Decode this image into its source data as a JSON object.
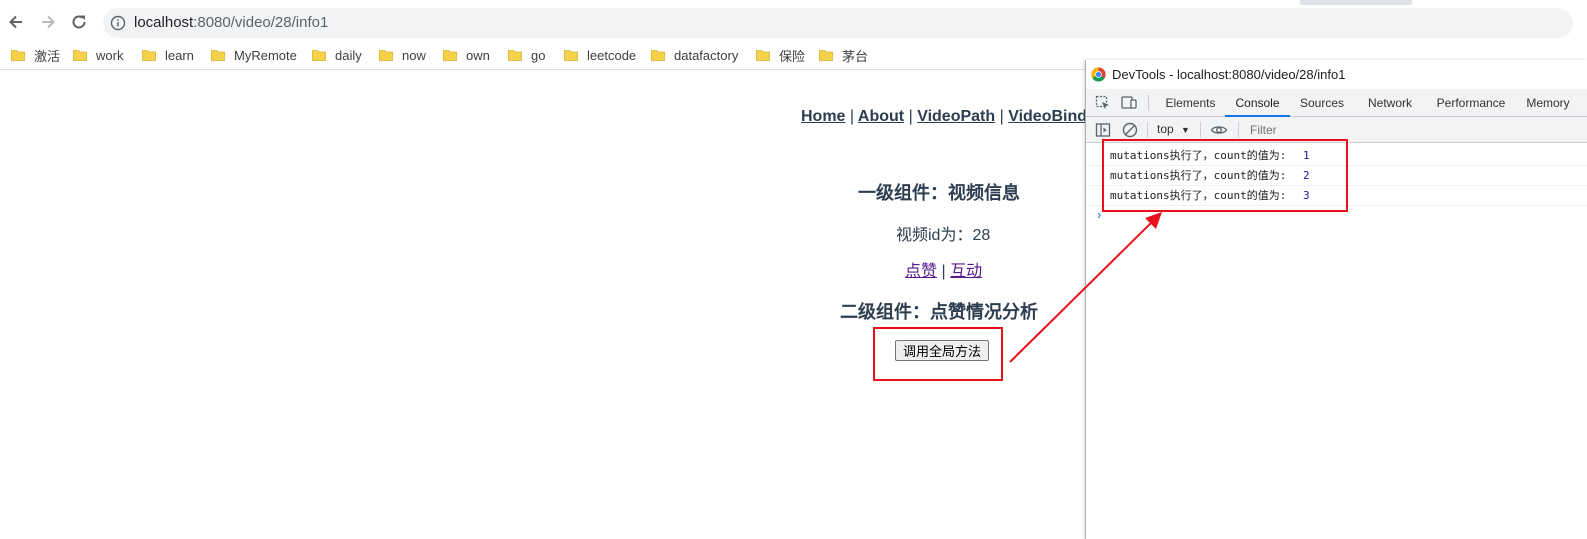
{
  "browser": {
    "url_host": "localhost",
    "url_path": ":8080/video/28/info1",
    "bookmarks": [
      "激活",
      "work",
      "learn",
      "MyRemote",
      "daily",
      "now",
      "own",
      "go",
      "leetcode",
      "datafactory",
      "保险",
      "茅台"
    ]
  },
  "page": {
    "nav": {
      "home": "Home",
      "about": "About",
      "video_path": "VideoPath",
      "video_bind": "VideoBind",
      "separator": "|"
    },
    "level1_title": "一级组件：视频信息",
    "video_id_text": "视频id为：28",
    "links": {
      "like": "点赞",
      "separator": "|",
      "interact": "互动"
    },
    "level2_title": "二级组件：点赞情况分析",
    "global_method_button": "调用全局方法"
  },
  "devtools": {
    "title": "DevTools - localhost:8080/video/28/info1",
    "tabs": [
      "Elements",
      "Console",
      "Sources",
      "Network",
      "Performance",
      "Memory"
    ],
    "active_tab": "Console",
    "context": "top",
    "filter_placeholder": "Filter",
    "logs": [
      {
        "message": "mutations执行了，count的值为:",
        "value": "1"
      },
      {
        "message": "mutations执行了，count的值为:",
        "value": "2"
      },
      {
        "message": "mutations执行了，count的值为:",
        "value": "3"
      }
    ],
    "prompt": "›"
  },
  "colors": {
    "annotation_red": "#e8101c",
    "link_color": "#2c3e50",
    "visited_link": "#551a8b",
    "devtools_active_tab": "#1a73e8",
    "console_number": "#1a1aa6",
    "bookmark_folder": "#f6d24b"
  }
}
